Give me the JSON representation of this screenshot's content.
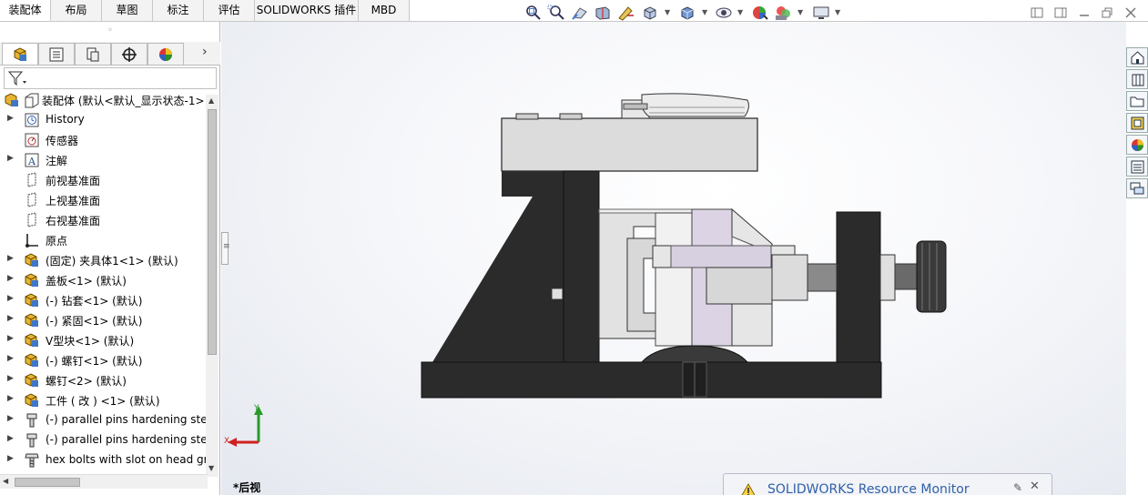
{
  "tabs": [
    {
      "label": "装配体",
      "active": true
    },
    {
      "label": "布局",
      "active": false
    },
    {
      "label": "草图",
      "active": false
    },
    {
      "label": "标注",
      "active": false
    },
    {
      "label": "评估",
      "active": false
    },
    {
      "label": "SOLIDWORKS 插件",
      "active": false
    },
    {
      "label": "MBD",
      "active": false
    }
  ],
  "toolbar_icons": [
    "zoom-to-fit-icon",
    "zoom-to-area-icon",
    "previous-view-icon",
    "section-view-icon",
    "dynamic-annotation-icon",
    "view-orientation-icon",
    "display-style-icon",
    "hide-show-icon",
    "edit-appearance-icon",
    "apply-scene-icon",
    "view-settings-icon"
  ],
  "panel_tabs": [
    "feature-manager-icon",
    "property-manager-icon",
    "configuration-manager-icon",
    "dimxpert-icon",
    "display-manager-icon"
  ],
  "tree": {
    "root": "装配体 (默认<默认_显示状态-1>",
    "items": [
      {
        "label": "History",
        "icon": "history-icon",
        "expandable": true
      },
      {
        "label": "传感器",
        "icon": "sensor-icon",
        "expandable": false
      },
      {
        "label": "注解",
        "icon": "annotation-icon",
        "expandable": true
      },
      {
        "label": "前视基准面",
        "icon": "plane-icon",
        "expandable": false
      },
      {
        "label": "上视基准面",
        "icon": "plane-icon",
        "expandable": false
      },
      {
        "label": "右视基准面",
        "icon": "plane-icon",
        "expandable": false
      },
      {
        "label": "原点",
        "icon": "origin-icon",
        "expandable": false
      },
      {
        "label": "(固定) 夹具体1<1> (默认)",
        "icon": "part-icon",
        "expandable": true
      },
      {
        "label": "盖板<1> (默认)",
        "icon": "part-icon",
        "expandable": true
      },
      {
        "label": "(-) 钻套<1> (默认)",
        "icon": "part-icon",
        "expandable": true
      },
      {
        "label": "(-) 紧固<1> (默认)",
        "icon": "part-icon",
        "expandable": true
      },
      {
        "label": "V型块<1> (默认)",
        "icon": "part-icon",
        "expandable": true
      },
      {
        "label": "(-) 螺钉<1> (默认)",
        "icon": "part-icon",
        "expandable": true
      },
      {
        "label": "螺钉<2> (默认)",
        "icon": "part-icon",
        "expandable": true
      },
      {
        "label": "工件 ( 改 ) <1> (默认)",
        "icon": "part-icon",
        "expandable": true
      },
      {
        "label": "(-) parallel pins hardening steel",
        "icon": "toolbox-pin-icon",
        "expandable": true
      },
      {
        "label": "(-) parallel pins hardening steel",
        "icon": "toolbox-pin-icon",
        "expandable": true
      },
      {
        "label": "hex bolts with slot on head grade",
        "icon": "toolbox-bolt-icon",
        "expandable": true
      }
    ]
  },
  "viewport": {
    "view_label": "*后视",
    "triad": {
      "y": "Y",
      "x": "X"
    }
  },
  "task_pane_icons": [
    "solidworks-resources-icon",
    "design-library-icon",
    "file-explorer-icon",
    "view-palette-icon",
    "appearances-icon",
    "custom-properties-icon",
    "forum-icon"
  ],
  "resource_monitor": {
    "title": "SOLIDWORKS Resource Monitor"
  },
  "colors": {
    "model_gray": "#d9d9d9",
    "model_dark": "#2b2b2b",
    "accent": "#3060a8"
  }
}
